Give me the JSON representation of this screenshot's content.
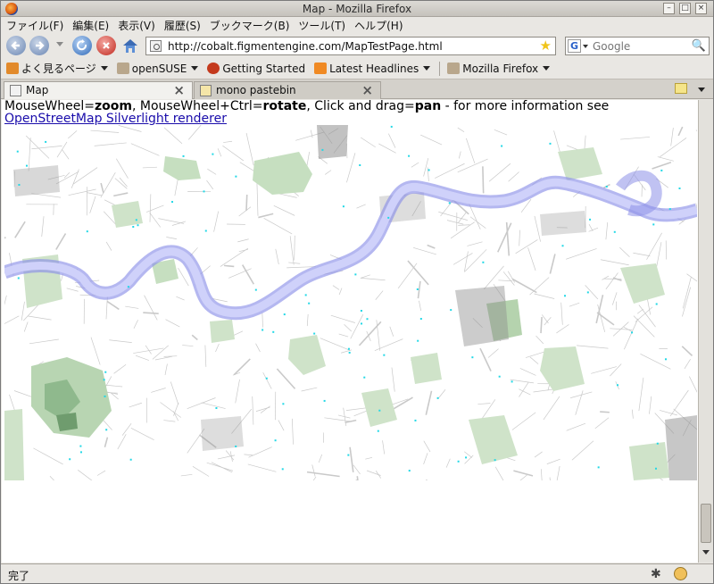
{
  "window": {
    "title": "Map - Mozilla Firefox",
    "controls": [
      "–",
      "□",
      "×"
    ]
  },
  "menu": [
    "ファイル(F)",
    "編集(E)",
    "表示(V)",
    "履歴(S)",
    "ブックマーク(B)",
    "ツール(T)",
    "ヘルプ(H)"
  ],
  "navigation": {
    "url": "http://cobalt.figmentengine.com/MapTestPage.html",
    "search_placeholder": "Google",
    "search_engine_letter": "G"
  },
  "bookmarks": [
    {
      "label": "よく見るページ",
      "dropdown": true,
      "icon": "rss-folder-icon",
      "color": "#e28a2b"
    },
    {
      "label": "openSUSE",
      "dropdown": true,
      "icon": "folder-icon",
      "color": "#b9a78c"
    },
    {
      "label": "Getting Started",
      "dropdown": false,
      "icon": "firefox-icon",
      "color": "#c43a1d"
    },
    {
      "label": "Latest Headlines",
      "dropdown": true,
      "icon": "rss-icon",
      "color": "#f08a24"
    },
    {
      "label": "Mozilla Firefox",
      "dropdown": true,
      "icon": "folder-icon",
      "color": "#b9a78c"
    }
  ],
  "tabs": [
    {
      "label": "Map",
      "active": true
    },
    {
      "label": "mono pastebin",
      "active": false
    }
  ],
  "page": {
    "instructions": {
      "p1": "MouseWheel=",
      "b1": "zoom",
      "p2": ", MouseWheel+Ctrl=",
      "b2": "rotate",
      "p3": ", Click and drag=",
      "b3": "pan",
      "p4": " - for more information see ",
      "link": "OpenStreetMap Silverlight renderer"
    }
  },
  "status": {
    "text": "完了"
  },
  "colors": {
    "river": "#b5b8f4",
    "river_edge": "#8c90e8",
    "park": "#c6dfc0",
    "park_dark": "#9bc49a",
    "road": "#c9c9c9",
    "block": "#8f8f8f",
    "poi": "#22d8e6"
  }
}
